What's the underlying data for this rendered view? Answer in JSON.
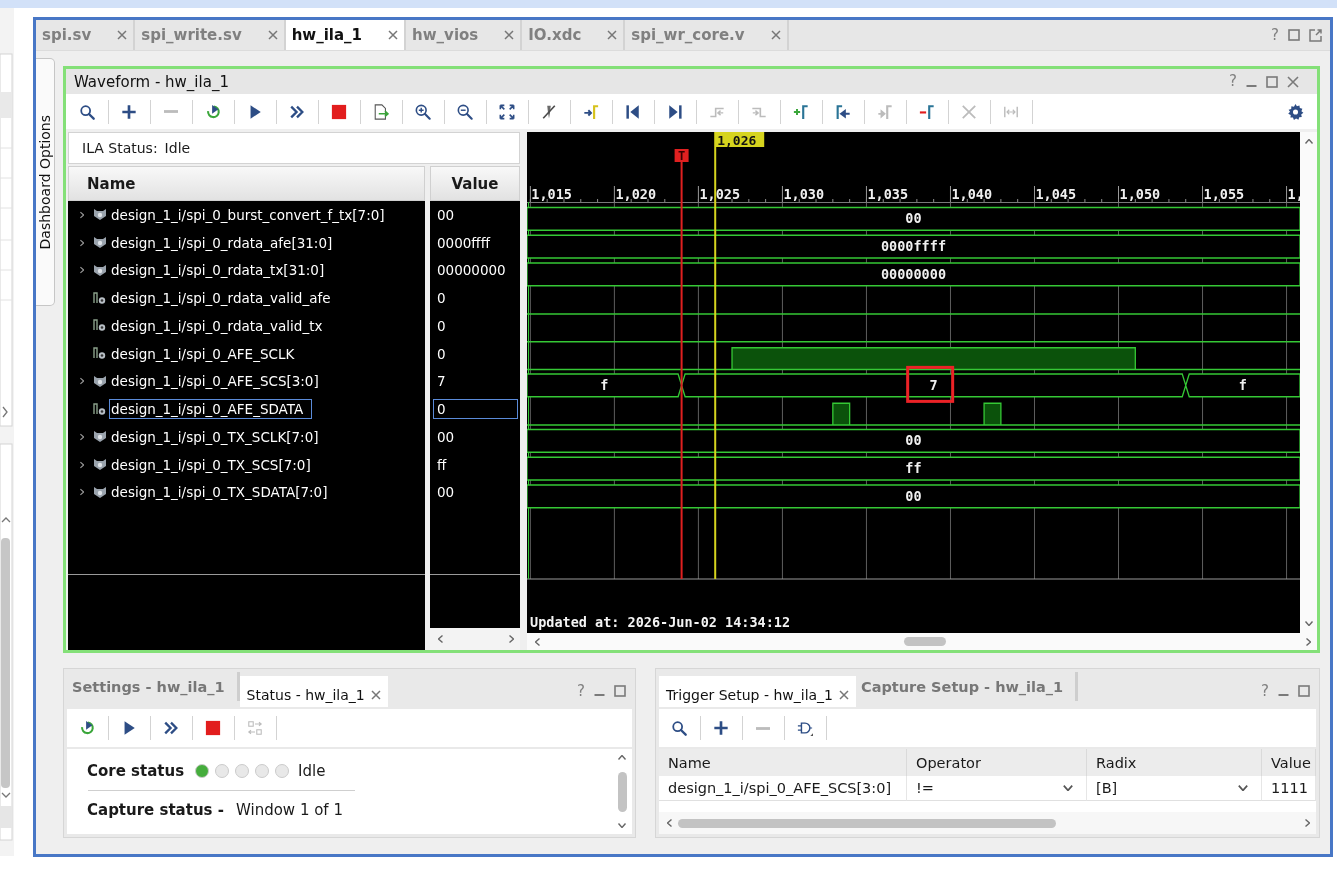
{
  "editor_tabs": [
    {
      "label": "spi.sv",
      "selected": false
    },
    {
      "label": "spi_write.sv",
      "selected": false
    },
    {
      "label": "hw_ila_1",
      "selected": true
    },
    {
      "label": "hw_vios",
      "selected": false
    },
    {
      "label": "IO.xdc",
      "selected": false
    },
    {
      "label": "spi_wr_core.v",
      "selected": false
    }
  ],
  "editor_help": "?",
  "side_tab": {
    "label": "Dashboard Options"
  },
  "waveform": {
    "title": "Waveform - hw_ila_1",
    "help": "?",
    "toolbar": [
      {
        "disabled": false
      },
      {
        "disabled": false
      },
      {
        "disabled": true
      },
      {
        "disabled": false
      },
      {
        "disabled": false
      },
      {
        "disabled": false
      },
      {
        "disabled": false
      },
      {
        "disabled": false
      },
      {
        "disabled": false
      },
      {
        "disabled": false
      },
      {
        "disabled": false
      },
      {
        "disabled": false
      },
      {
        "disabled": false
      },
      {
        "disabled": false
      },
      {
        "disabled": false
      },
      {
        "disabled": true
      },
      {
        "disabled": true
      },
      {
        "disabled": false
      },
      {
        "disabled": false
      },
      {
        "disabled": true
      },
      {
        "disabled": false
      },
      {
        "disabled": true
      },
      {
        "disabled": true
      }
    ],
    "ila_status": {
      "label": "ILA Status:",
      "value": "Idle"
    },
    "columns": [
      "Name",
      "Value"
    ],
    "signals": [
      {
        "name": "design_1_i/spi_0_burst_convert_f_tx[7:0]",
        "value": "00",
        "kind": "bus",
        "selected": false,
        "trace_labels": [
          {
            "text": "00",
            "highlighted": false
          }
        ]
      },
      {
        "name": "design_1_i/spi_0_rdata_afe[31:0]",
        "value": "0000ffff",
        "kind": "bus",
        "selected": false,
        "trace_labels": [
          {
            "text": "0000ffff",
            "highlighted": false
          }
        ]
      },
      {
        "name": "design_1_i/spi_0_rdata_tx[31:0]",
        "value": "00000000",
        "kind": "bus",
        "selected": false,
        "trace_labels": [
          {
            "text": "00000000",
            "highlighted": false
          }
        ]
      },
      {
        "name": "design_1_i/spi_0_rdata_valid_afe",
        "value": "0",
        "kind": "bit",
        "selected": false
      },
      {
        "name": "design_1_i/spi_0_rdata_valid_tx",
        "value": "0",
        "kind": "bit",
        "selected": false
      },
      {
        "name": "design_1_i/spi_0_AFE_SCLK",
        "value": "0",
        "kind": "bit",
        "selected": false
      },
      {
        "name": "design_1_i/spi_0_AFE_SCS[3:0]",
        "value": "7",
        "kind": "bus",
        "selected": false,
        "trace_labels": [
          {
            "text": "f",
            "highlighted": false
          },
          {
            "text": "7",
            "highlighted": true
          },
          {
            "text": "f",
            "highlighted": false
          }
        ]
      },
      {
        "name": "design_1_i/spi_0_AFE_SDATA",
        "value": "0",
        "kind": "bit",
        "selected": true
      },
      {
        "name": "design_1_i/spi_0_TX_SCLK[7:0]",
        "value": "00",
        "kind": "bus",
        "selected": false,
        "trace_labels": [
          {
            "text": "00",
            "highlighted": false
          }
        ]
      },
      {
        "name": "design_1_i/spi_0_TX_SCS[7:0]",
        "value": "ff",
        "kind": "bus",
        "selected": false,
        "trace_labels": [
          {
            "text": "ff",
            "highlighted": false
          }
        ]
      },
      {
        "name": "design_1_i/spi_0_TX_SDATA[7:0]",
        "value": "00",
        "kind": "bus",
        "selected": false,
        "trace_labels": [
          {
            "text": "00",
            "highlighted": false
          }
        ]
      }
    ],
    "time_labels": [
      "1,015",
      "1,020",
      "1,025",
      "1,030",
      "1,035",
      "1,040",
      "1,045",
      "1,050",
      "1,055",
      "1,"
    ],
    "cursor_label": "1,026",
    "trigger_label": "T",
    "updated": "Updated at: 2026-Jun-02 14:34:12"
  },
  "status_panel": {
    "tabs": [
      {
        "label": "Settings - hw_ila_1",
        "selected": false
      },
      {
        "label": "Status - hw_ila_1",
        "selected": true
      }
    ],
    "help": "?",
    "toolbar": [
      {
        "disabled": false
      },
      {
        "disabled": false
      },
      {
        "disabled": false
      },
      {
        "disabled": false
      },
      {
        "disabled": true
      }
    ],
    "core_status": {
      "label": "Core status",
      "indicators": [
        {
          "color": "#45ad3c"
        },
        {
          "color": "#e8e8e8"
        },
        {
          "color": "#e8e8e8"
        },
        {
          "color": "#e8e8e8"
        },
        {
          "color": "#e8e8e8"
        }
      ],
      "value": "Idle"
    },
    "capture_status": {
      "label": "Capture status -",
      "value": "Window 1 of 1"
    }
  },
  "trigger_panel": {
    "tabs": [
      {
        "label": "Trigger Setup - hw_ila_1",
        "selected": true
      },
      {
        "label": "Capture Setup - hw_ila_1",
        "selected": false
      }
    ],
    "help": "?",
    "toolbar": [
      {
        "disabled": false
      },
      {
        "disabled": false
      },
      {
        "disabled": true
      },
      {
        "disabled": false
      }
    ],
    "columns": [
      "Name",
      "Operator",
      "Radix",
      "Value"
    ],
    "rows": [
      {
        "name": "design_1_i/spi_0_AFE_SCS[3:0]",
        "operator": "!=",
        "radix": "[B]",
        "value": "1111"
      }
    ]
  }
}
